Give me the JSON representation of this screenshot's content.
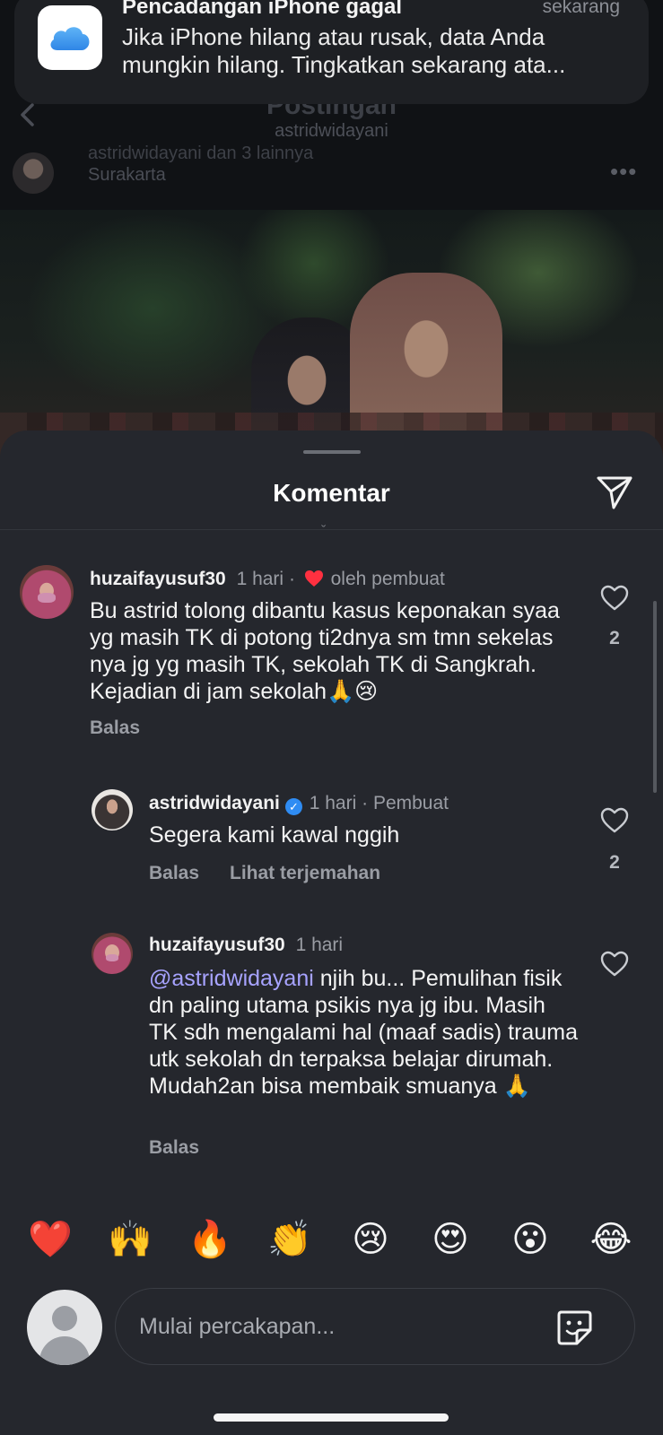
{
  "notification": {
    "app_icon": "icloud-icon",
    "title": "Pencadangan iPhone gagal",
    "time": "sekarang",
    "body": "Jika iPhone hilang atau rusak, data Anda mungkin hilang. Tingkatkan sekarang ata..."
  },
  "post": {
    "header_title": "Postingan",
    "header_subtitle": "astridwidayani",
    "author_line": "astridwidayani dan 3 lainnya",
    "location": "Surakarta",
    "more_icon": "more-horizontal-icon"
  },
  "sheet": {
    "title": "Komentar",
    "share_icon": "send-icon"
  },
  "comments": [
    {
      "username": "huzaifayusuf30",
      "time": "1 hari",
      "badge": "oleh pembuat",
      "text": "Bu astrid tolong dibantu kasus keponakan syaa yg masih TK di potong ti2dnya sm tmn sekelas nya jg yg masih TK, sekolah TK di Sangkrah. Kejadian di jam sekolah🙏😢",
      "reply_label": "Balas",
      "likes": "2"
    },
    {
      "username": "astridwidayani",
      "time": "1 hari",
      "badge": "Pembuat",
      "text": "Segera kami kawal nggih",
      "reply_label": "Balas",
      "translate_label": "Lihat terjemahan",
      "likes": "2"
    },
    {
      "username": "huzaifayusuf30",
      "time": "1 hari",
      "mention": "@astridwidayani",
      "text": " njih bu... Pemulihan fisik dn paling utama psikis nya jg ibu. Masih TK sdh mengalami hal (maaf sadis) trauma utk sekolah dn terpaksa belajar dirumah. Mudah2an bisa membaik smuanya 🙏",
      "reply_label": "Balas"
    }
  ],
  "reactions": [
    "❤️",
    "🙌",
    "🔥",
    "👏",
    "😢",
    "😍",
    "😮",
    "😂"
  ],
  "composer": {
    "placeholder": "Mulai percakapan...",
    "sticker_icon": "sticker-icon"
  },
  "colors": {
    "sheet_bg": "#25272d",
    "mention": "#a7a3ff",
    "verified": "#2f8cf3",
    "heart": "#ff3040"
  }
}
